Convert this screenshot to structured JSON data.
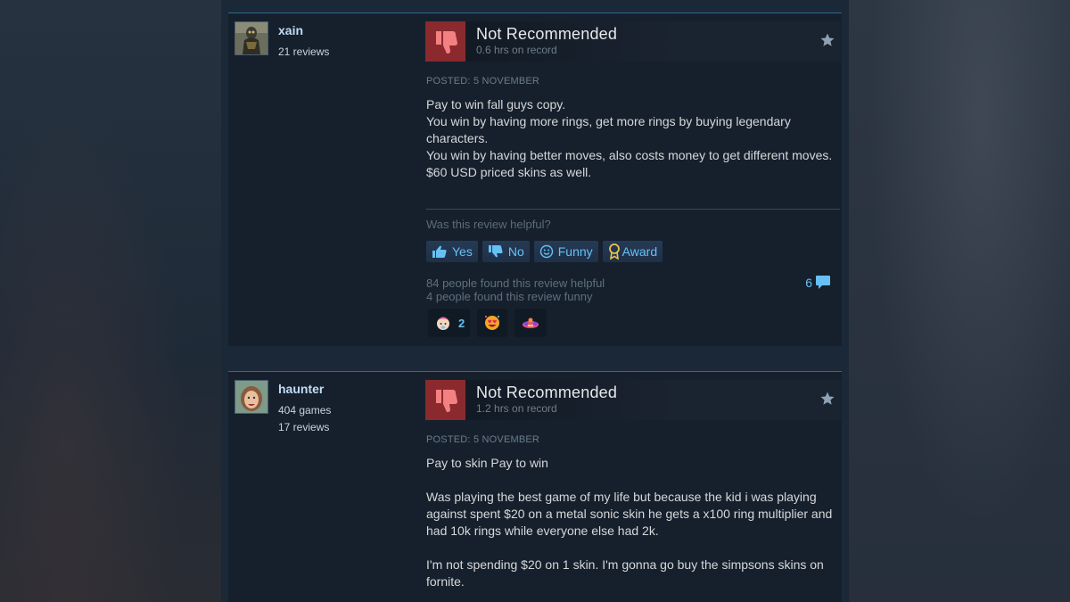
{
  "reviews": [
    {
      "username": "xain",
      "games": "",
      "reviews_count": "21 reviews",
      "verdict": "Not Recommended",
      "hours": "0.6 hrs on record",
      "posted": "POSTED: 5 NOVEMBER",
      "body": [
        "Pay to win fall guys copy.",
        "You win by having more rings, get more rings by buying legendary characters.",
        "You win by having better moves, also costs money to get different moves.",
        "$60 USD priced skins as well."
      ],
      "helpful_question": "Was this review helpful?",
      "buttons": {
        "yes": "Yes",
        "no": "No",
        "funny": "Funny",
        "award": "Award"
      },
      "helpful_text": "84 people found this review helpful",
      "funny_text": "4 people found this review funny",
      "comment_count": "6",
      "awards": [
        {
          "icon": "baby-award-icon",
          "count": "2"
        },
        {
          "icon": "heart-eyes-award-icon",
          "count": ""
        },
        {
          "icon": "clown-award-icon",
          "count": ""
        }
      ]
    },
    {
      "username": "haunter",
      "games": "404 games",
      "reviews_count": "17 reviews",
      "verdict": "Not Recommended",
      "hours": "1.2 hrs on record",
      "posted": "POSTED: 5 NOVEMBER",
      "body": [
        "Pay to skin Pay to win",
        "",
        "Was playing the best game of my life but because the kid i was playing against spent $20 on a metal sonic skin he gets a x100 ring multiplier and had 10k rings while everyone else had 2k.",
        "",
        "I'm not spending $20 on 1 skin. I'm gonna go buy the simpsons skins on fornite."
      ]
    }
  ],
  "colors": {
    "thumb_down_bg": "#8a2a2e",
    "link_blue": "#66c0f4",
    "username": "#c1dbf4"
  }
}
